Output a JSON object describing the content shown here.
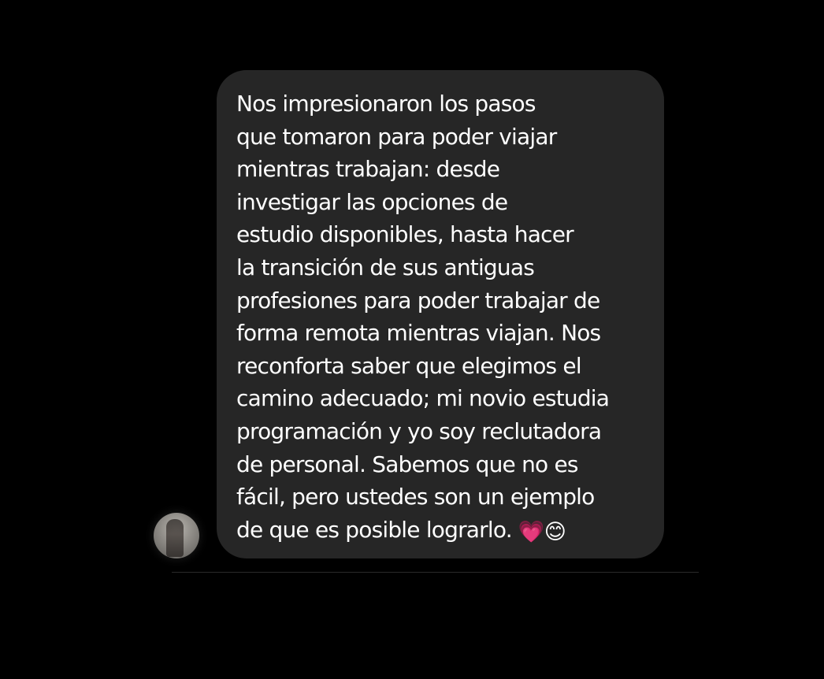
{
  "message": {
    "text": "Nos impresionaron los pasos\nque tomaron para poder viajar\nmientras trabajan: desde\ninvestigar las opciones de\nestudio disponibles, hasta hacer\nla transición de sus antiguas\nprofesiones para poder trabajar de\nforma remota mientras viajan. Nos\nreconforta saber que elegimos el\ncamino adecuado; mi novio estudia\nprogramación y yo soy reclutadora\nde personal. Sabemos que no es\nfácil, pero ustedes son un ejemplo\nde que es posible lograrlo. ",
    "emoji_heart": "💗",
    "emoji_smile": "😊"
  },
  "avatar": {
    "icon": "profile-photo"
  },
  "colors": {
    "background": "#000000",
    "bubble": "#262626",
    "text": "#ffffff"
  }
}
